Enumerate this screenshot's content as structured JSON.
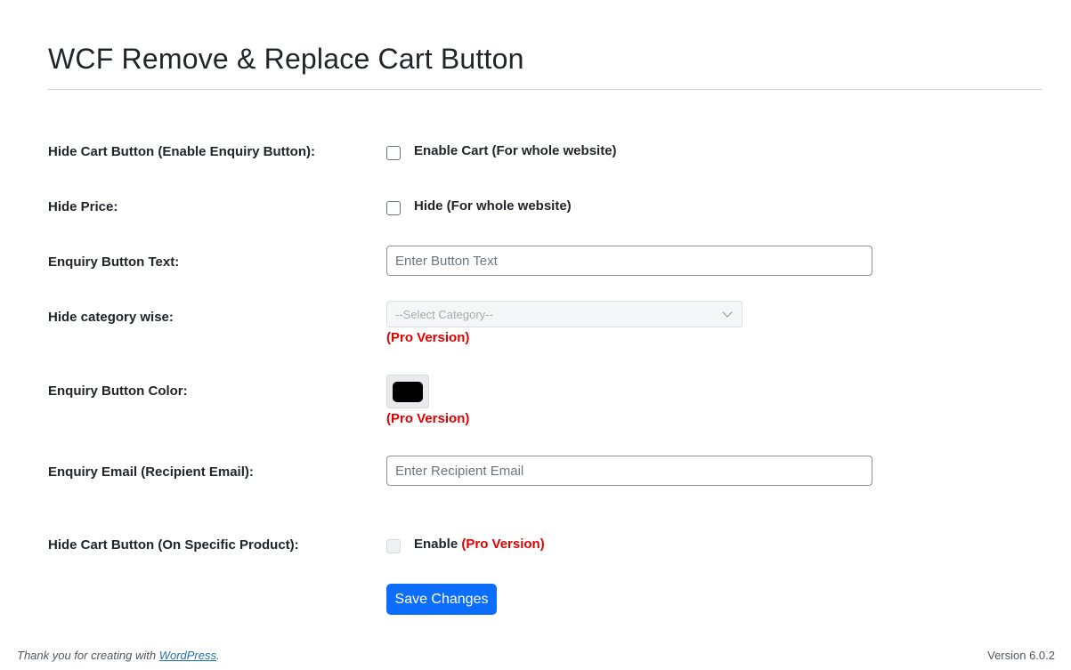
{
  "page": {
    "title": "WCF Remove & Replace Cart Button"
  },
  "form": {
    "hide_cart": {
      "label": "Hide Cart Button (Enable Enquiry Button):",
      "checkbox_label": "Enable Cart (For whole website)",
      "checked": false
    },
    "hide_price": {
      "label": "Hide Price:",
      "checkbox_label": "Hide (For whole website)",
      "checked": false
    },
    "enquiry_text": {
      "label": "Enquiry Button Text:",
      "placeholder": "Enter Button Text",
      "value": ""
    },
    "category": {
      "label": "Hide category wise:",
      "selected": "--Select Category--",
      "pro_note": "(Pro Version)"
    },
    "button_color": {
      "label": "Enquiry Button Color:",
      "color": "#000000",
      "pro_note": "(Pro Version)"
    },
    "enquiry_email": {
      "label": "Enquiry Email (Recipient Email):",
      "placeholder": "Enter Recipient Email",
      "value": ""
    },
    "specific_product": {
      "label": "Hide Cart Button (On Specific Product):",
      "checkbox_label": "Enable",
      "pro_note": "(Pro Version)",
      "checked": false,
      "disabled": true
    },
    "save_label": "Save Changes"
  },
  "footer": {
    "thanks_prefix": "Thank you for creating with ",
    "thanks_link": "WordPress",
    "thanks_suffix": ".",
    "version": "Version 6.0.2"
  },
  "colors": {
    "accent": "#0d6efd",
    "pro": "#e30000",
    "link": "#2271b1"
  }
}
